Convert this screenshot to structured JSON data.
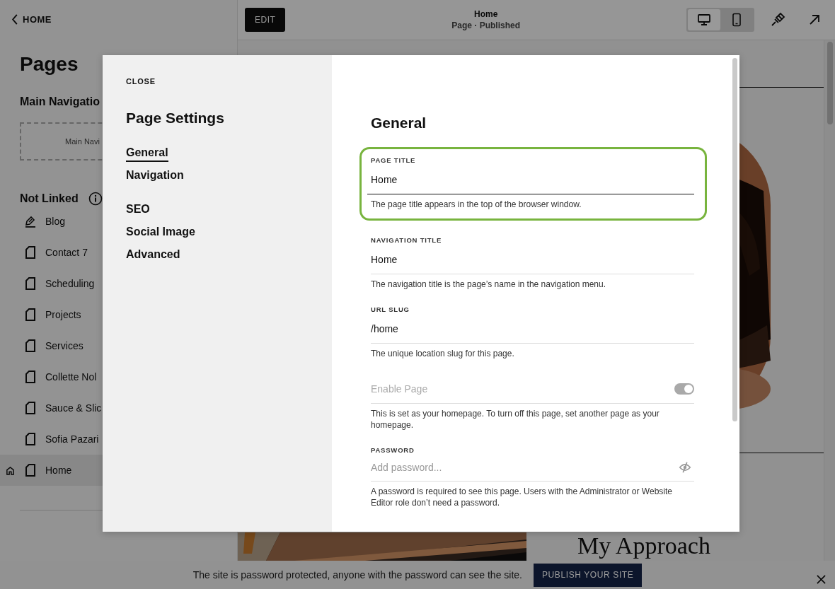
{
  "sidebar": {
    "back_link": "HOME",
    "title": "Pages",
    "main_navigation": {
      "heading": "Main Navigatio",
      "placeholder": "Main Navi"
    },
    "not_linked": {
      "heading": "Not Linked"
    },
    "pages": [
      {
        "label": "Blog",
        "kind": "blog",
        "homepage": false,
        "selected": false
      },
      {
        "label": "Contact 7",
        "kind": "page",
        "homepage": false,
        "selected": false
      },
      {
        "label": "Scheduling",
        "kind": "page",
        "homepage": false,
        "selected": false
      },
      {
        "label": "Projects",
        "kind": "page",
        "homepage": false,
        "selected": false
      },
      {
        "label": "Services",
        "kind": "page",
        "homepage": false,
        "selected": false
      },
      {
        "label": "Collette Nol",
        "kind": "page",
        "homepage": false,
        "selected": false
      },
      {
        "label": "Sauce & Slic",
        "kind": "page",
        "homepage": false,
        "selected": false
      },
      {
        "label": "Sofia Pazari",
        "kind": "page",
        "homepage": false,
        "selected": false
      },
      {
        "label": "Home",
        "kind": "page",
        "homepage": true,
        "selected": true
      }
    ]
  },
  "toolbar": {
    "edit_button": "EDIT",
    "page_title": "Home",
    "page_status": "Page · Published",
    "devices": [
      {
        "kind": "desktop",
        "selected": true
      },
      {
        "kind": "mobile",
        "selected": false
      }
    ]
  },
  "preview": {
    "heading": "My Approach"
  },
  "modal": {
    "close": "CLOSE",
    "title": "Page Settings",
    "nav_groups": [
      [
        {
          "label": "General",
          "selected": true
        },
        {
          "label": "Navigation",
          "selected": false
        }
      ],
      [
        {
          "label": "SEO",
          "selected": false
        },
        {
          "label": "Social Image",
          "selected": false
        },
        {
          "label": "Advanced",
          "selected": false
        }
      ]
    ],
    "section_title": "General",
    "fields": [
      {
        "kind": "text",
        "label": "PAGE TITLE",
        "value": "Home",
        "help": "The page title appears in the top of the browser window.",
        "highlighted": true
      },
      {
        "kind": "text",
        "label": "NAVIGATION TITLE",
        "value": "Home",
        "help": "The navigation title is the page’s name in the navigation menu.",
        "highlighted": false
      },
      {
        "kind": "text",
        "label": "URL SLUG",
        "value": "/home",
        "help": "The unique location slug for this page.",
        "highlighted": false
      },
      {
        "kind": "toggle",
        "label": "Enable Page",
        "on": true,
        "disabled": true,
        "help": "This is set as your homepage. To turn off this page, set another page as your homepage."
      },
      {
        "kind": "password",
        "label": "PASSWORD",
        "placeholder": "Add password...",
        "help": "A password is required to see this page. Users with the Administrator or Website Editor role don’t need a password."
      }
    ]
  },
  "banner": {
    "message": "The site is password protected, anyone with the password can see the site.",
    "button": "PUBLISH YOUR SITE"
  }
}
